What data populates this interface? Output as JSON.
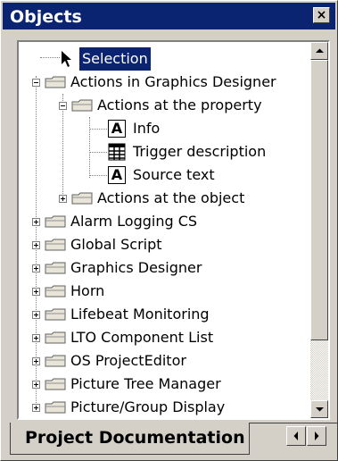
{
  "window": {
    "title": "Objects",
    "close_glyph": "×"
  },
  "tree": {
    "items": [
      {
        "label": "Selection",
        "icon": "arrow-pointer-icon",
        "selected": true
      },
      {
        "label": "Actions in Graphics Designer",
        "icon": "folder-icon",
        "expanded": true
      },
      {
        "label": "Actions at the property",
        "icon": "folder-icon",
        "expanded": true
      },
      {
        "label": "Info",
        "icon": "text-a-icon"
      },
      {
        "label": "Trigger description",
        "icon": "table-icon"
      },
      {
        "label": "Source text",
        "icon": "text-a-icon"
      },
      {
        "label": "Actions at the object",
        "icon": "folder-icon",
        "expanded": false
      },
      {
        "label": "Alarm Logging CS",
        "icon": "folder-icon",
        "expanded": false
      },
      {
        "label": "Global Script",
        "icon": "folder-icon",
        "expanded": false
      },
      {
        "label": "Graphics Designer",
        "icon": "folder-icon",
        "expanded": false
      },
      {
        "label": "Horn",
        "icon": "folder-icon",
        "expanded": false
      },
      {
        "label": "Lifebeat Monitoring",
        "icon": "folder-icon",
        "expanded": false
      },
      {
        "label": "LTO Component List",
        "icon": "folder-icon",
        "expanded": false
      },
      {
        "label": "OS ProjectEditor",
        "icon": "folder-icon",
        "expanded": false
      },
      {
        "label": "Picture Tree Manager",
        "icon": "folder-icon",
        "expanded": false
      },
      {
        "label": "Picture/Group Display",
        "icon": "folder-icon",
        "expanded": false
      }
    ],
    "text_a_glyph": "A"
  },
  "tabs": {
    "active_label": "Project Documentation"
  },
  "colors": {
    "titlebar": "#0b2472",
    "selection": "#0b2472",
    "face": "#d4d0c8"
  }
}
